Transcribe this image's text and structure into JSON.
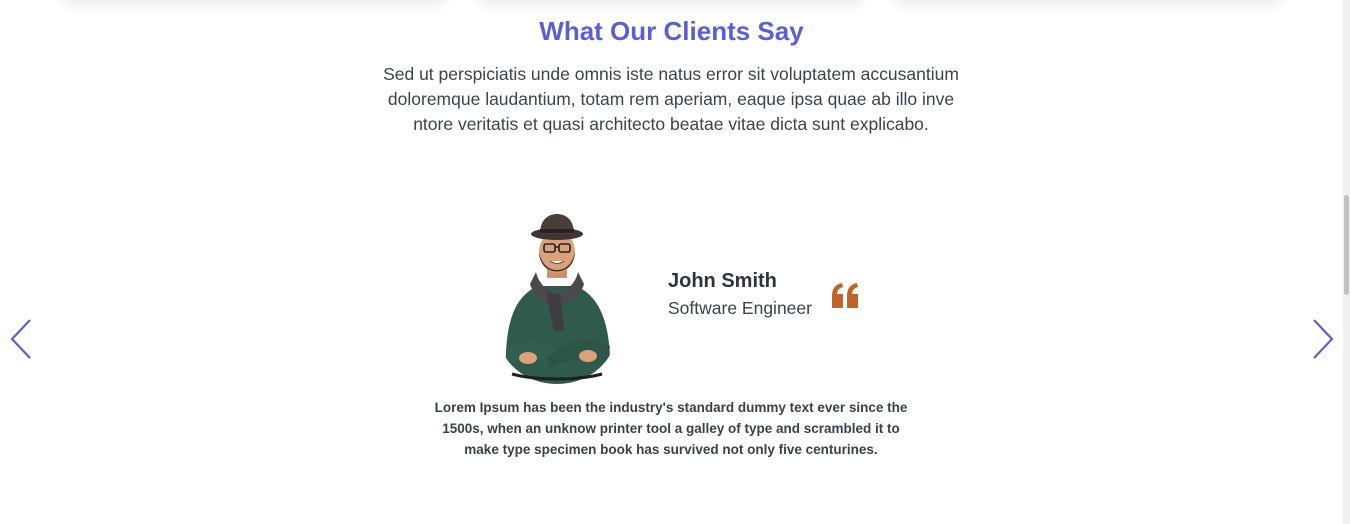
{
  "testimonials": {
    "title": "What Our Clients Say",
    "intro": "Sed ut perspiciatis unde omnis iste natus error sit voluptatem accusantium doloremque laudantium, totam rem aperiam, eaque ipsa quae ab illo inve ntore veritatis et quasi architecto beatae vitae dicta sunt explicabo.",
    "active": {
      "name": "John Smith",
      "role": "Software Engineer",
      "quote": "Lorem Ipsum has been the industry's standard dummy text ever since the 1500s, when an unknow printer tool a galley of type and scrambled it to make type specimen book has survived not only five centurines."
    },
    "icons": {
      "prev": "chevron-left-icon",
      "next": "chevron-right-icon",
      "quote": "quote-icon"
    }
  },
  "colors": {
    "title": "#5a5fd6",
    "arrow": "#5a5fd6",
    "quote": "#c0652a",
    "text": "#3a3f4b"
  }
}
